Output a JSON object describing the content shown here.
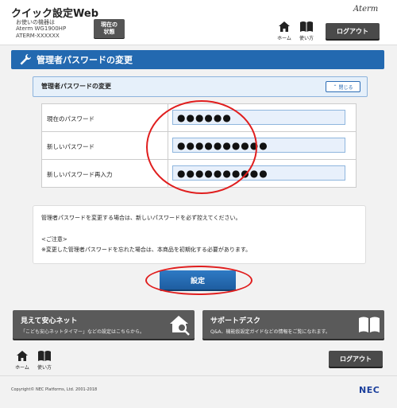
{
  "header": {
    "app_title": "クイック設定Web",
    "device_lines": [
      "お使いの機器は",
      "Aterm WG1900HP",
      "ATERM-XXXXXX"
    ],
    "status_button": [
      "現在の",
      "状態"
    ],
    "brand": "Aterm",
    "home_label": "ホーム",
    "manual_label": "使い方",
    "logout_label": "ログアウト"
  },
  "page": {
    "title": "管理者パスワードの変更"
  },
  "panel": {
    "title": "管理者パスワードの変更",
    "close_label": "閉じる"
  },
  "form": {
    "rows": [
      {
        "label": "現在のパスワード",
        "value": "●●●●●●"
      },
      {
        "label": "新しいパスワード",
        "value": "●●●●●●●●●●"
      },
      {
        "label": "新しいパスワード再入力",
        "value": "●●●●●●●●●●"
      }
    ]
  },
  "notes": {
    "main": "管理者パスワードを変更する場合は、新しいパスワードを必ず控えてください。",
    "caution_title": "<ご注意>",
    "caution_text": "※変更した管理者パスワードを忘れた場合は、本商品を初期化する必要があります。"
  },
  "actions": {
    "set_label": "設定"
  },
  "cards": [
    {
      "title": "見えて安心ネット",
      "desc": "「こども安心ネットタイマー」などの設定はこちらから。",
      "icon": "house-search-icon"
    },
    {
      "title": "サポートデスク",
      "desc": "Q&A、機能仮設定ガイドなどの情報をご覧になれます。",
      "icon": "book-icon"
    }
  ],
  "footer": {
    "home_label": "ホーム",
    "manual_label": "使い方",
    "logout_label": "ログアウト",
    "copyright": "Copyright© NEC Platforms, Ltd. 2001-2018",
    "logo": "NEC"
  },
  "colors": {
    "accent": "#2369b0",
    "annotation": "#e01e1e"
  }
}
